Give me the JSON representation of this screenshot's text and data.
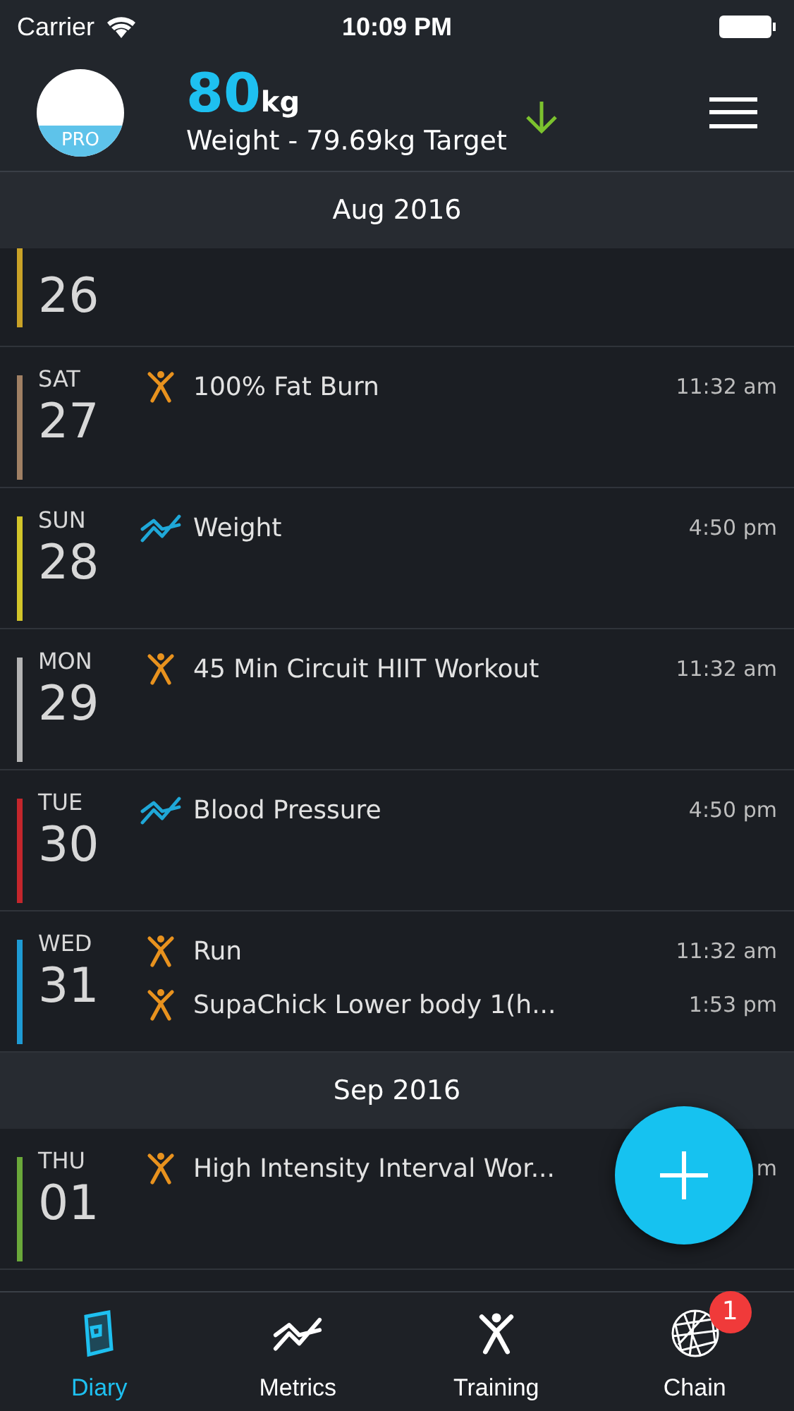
{
  "status_bar": {
    "carrier": "Carrier",
    "time": "10:09 PM"
  },
  "header": {
    "avatar_badge": "PRO",
    "value": "80",
    "unit": "kg",
    "subtitle": "Weight - 79.69kg Target",
    "trending_down": true
  },
  "sections": [
    {
      "month": "Aug 2016",
      "days": [
        {
          "date": "26",
          "color": "#c9a227",
          "partial": true
        },
        {
          "day": "SAT",
          "date": "27",
          "color": "#a08064",
          "entries": [
            {
              "kind": "workout",
              "title": "100% Fat Burn",
              "time": "11:32 am"
            }
          ]
        },
        {
          "day": "SUN",
          "date": "28",
          "color": "#d2c52a",
          "entries": [
            {
              "kind": "metric",
              "title": "Weight",
              "time": "4:50 pm"
            }
          ]
        },
        {
          "day": "MON",
          "date": "29",
          "color": "#b4b4b4",
          "entries": [
            {
              "kind": "workout",
              "title": "45 Min Circuit HIIT Workout",
              "time": "11:32 am"
            }
          ]
        },
        {
          "day": "TUE",
          "date": "30",
          "color": "#c4262c",
          "entries": [
            {
              "kind": "metric",
              "title": "Blood Pressure",
              "time": "4:50 pm"
            }
          ]
        },
        {
          "day": "WED",
          "date": "31",
          "color": "#1e9bd4",
          "entries": [
            {
              "kind": "workout",
              "title": "Run",
              "time": "11:32 am"
            },
            {
              "kind": "workout",
              "title": "SupaChick Lower body 1(h...",
              "time": "1:53 pm"
            }
          ]
        }
      ]
    },
    {
      "month": "Sep 2016",
      "days": [
        {
          "day": "THU",
          "date": "01",
          "color": "#6aa83a",
          "entries": [
            {
              "kind": "workout",
              "title": "High Intensity Interval Wor...",
              "time": "m"
            }
          ]
        }
      ]
    }
  ],
  "tabs": [
    {
      "label": "Diary",
      "kind": "diary",
      "selected": true
    },
    {
      "label": "Metrics",
      "kind": "metrics",
      "selected": false
    },
    {
      "label": "Training",
      "kind": "training",
      "selected": false
    },
    {
      "label": "Chain",
      "kind": "chain",
      "selected": false,
      "badge": "1"
    }
  ]
}
